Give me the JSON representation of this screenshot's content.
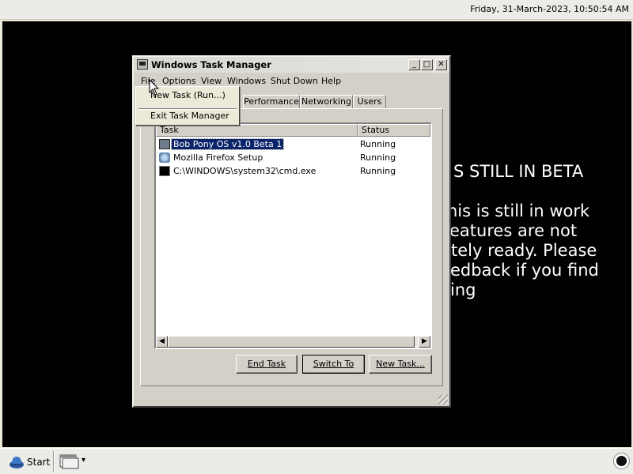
{
  "topbar": {
    "clock": "Friday, 31-March-2023, 10:50:54 AM"
  },
  "desktop": {
    "background_lines": [
      "S STILL IN BETA",
      "his is still in work",
      "eatures are not",
      "tely ready. Please",
      "edback if you find",
      "ing"
    ]
  },
  "window": {
    "title": "Windows Task Manager",
    "title_buttons": {
      "minimize": "_",
      "maximize": "□",
      "close": "✕"
    },
    "menu": [
      "File",
      "Options",
      "View",
      "Windows",
      "Shut Down",
      "Help"
    ],
    "tabs": [
      "Performance",
      "Networking",
      "Users"
    ],
    "list": {
      "headers": {
        "task": "Task",
        "status": "Status"
      },
      "rows": [
        {
          "task": "Bob Pony OS v1.0 Beta 1",
          "status": "Running",
          "icon": "app-window-icon",
          "selected": true
        },
        {
          "task": "Mozilla Firefox Setup",
          "status": "Running",
          "icon": "installer-icon",
          "selected": false
        },
        {
          "task": "C:\\WINDOWS\\system32\\cmd.exe",
          "status": "Running",
          "icon": "cmd-icon",
          "selected": false
        }
      ],
      "scroll_left": "◀",
      "scroll_right": "▶"
    },
    "buttons": {
      "end_task": "End Task",
      "switch_to": "Switch To",
      "new_task": "New Task..."
    }
  },
  "file_menu": {
    "items": [
      "New Task (Run...)",
      "Exit Task Manager"
    ]
  },
  "taskbar": {
    "start_label": "Start",
    "window_selector_arrow": "▾"
  },
  "colors": {
    "desktop_bg": "#000000",
    "selection": "#0a246a",
    "window_face": "#d4d0c8"
  }
}
